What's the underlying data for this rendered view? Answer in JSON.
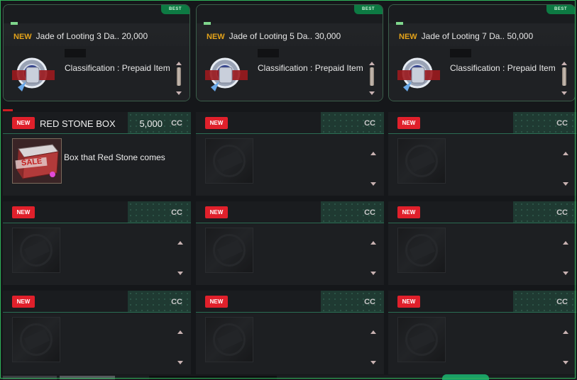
{
  "featured": [
    {
      "badge": "BEST",
      "new": "NEW",
      "name": "Jade of Looting 3 Da..",
      "price": "20,000",
      "description": "Classification : Prepaid Item",
      "icon": "jade-of-looting-icon"
    },
    {
      "badge": "BEST",
      "new": "NEW",
      "name": "Jade of Looting 5 Da..",
      "price": "30,000",
      "description": "Classification : Prepaid Item",
      "icon": "jade-of-looting-icon"
    },
    {
      "badge": "BEST",
      "new": "NEW",
      "name": "Jade of Looting 7 Da..",
      "price": "50,000",
      "description": "Classification : Prepaid Item",
      "icon": "jade-of-looting-icon"
    }
  ],
  "items": [
    {
      "new": "NEW",
      "name": "RED STONE BOX",
      "price": "5,000",
      "currency": "CC",
      "description": "Box that Red Stone comes",
      "icon": "red-stone-box-icon"
    },
    {
      "new": "NEW",
      "name": "",
      "price": "",
      "currency": "CC",
      "description": ""
    },
    {
      "new": "NEW",
      "name": "",
      "price": "",
      "currency": "CC",
      "description": ""
    },
    {
      "new": "NEW",
      "name": "",
      "price": "",
      "currency": "CC",
      "description": ""
    },
    {
      "new": "NEW",
      "name": "",
      "price": "",
      "currency": "CC",
      "description": ""
    },
    {
      "new": "NEW",
      "name": "",
      "price": "",
      "currency": "CC",
      "description": ""
    },
    {
      "new": "NEW",
      "name": "",
      "price": "",
      "currency": "CC",
      "description": ""
    },
    {
      "new": "NEW",
      "name": "",
      "price": "",
      "currency": "CC",
      "description": ""
    },
    {
      "new": "NEW",
      "name": "",
      "price": "",
      "currency": "CC",
      "description": ""
    }
  ],
  "box_label": "SALE",
  "colors": {
    "accent_green": "#2fb35a",
    "badge_red": "#e0202b",
    "new_gold": "#e3a21a",
    "best_green": "#0d7a43"
  }
}
